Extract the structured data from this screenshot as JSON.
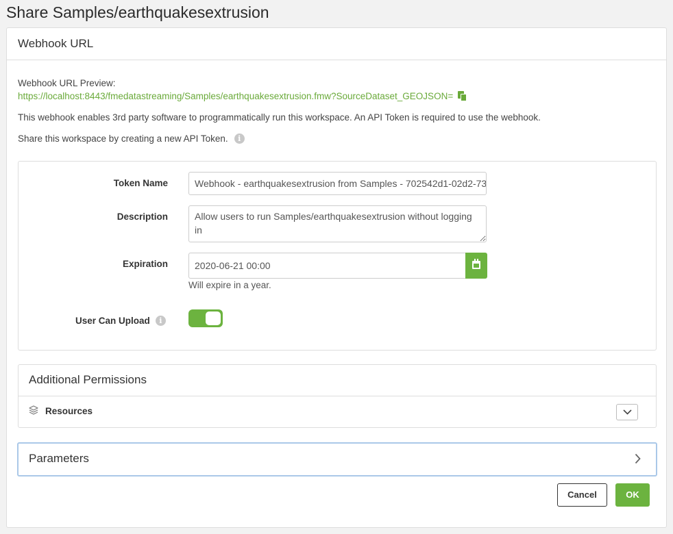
{
  "page": {
    "title": "Share Samples/earthquakesextrusion"
  },
  "webhook": {
    "section_title": "Webhook URL",
    "preview_label": "Webhook URL Preview:",
    "preview_url": "https://localhost:8443/fmedatastreaming/Samples/earthquakesextrusion.fmw?SourceDataset_GEOJSON=",
    "copy_icon": "copy-icon",
    "description": "This webhook enables 3rd party software to programmatically run this workspace. An API Token is required to use the webhook.",
    "share_text": "Share this workspace by creating a new API Token.",
    "info_icon": "info-icon"
  },
  "form": {
    "token_name_label": "Token Name",
    "token_name_value": "Webhook - earthquakesextrusion from Samples - 702542d1-02d2-73",
    "description_label": "Description",
    "description_value": "Allow users to run Samples/earthquakesextrusion without logging in",
    "expiration_label": "Expiration",
    "expiration_value": "2020-06-21 00:00",
    "calendar_icon": "calendar-icon",
    "expiration_hint": "Will expire in a year.",
    "upload_label": "User Can Upload",
    "upload_enabled": true
  },
  "permissions": {
    "section_title": "Additional Permissions",
    "resources_label": "Resources",
    "resources_icon": "layers-icon",
    "expand_icon": "chevron-down-icon"
  },
  "parameters": {
    "label": "Parameters",
    "chevron_icon": "chevron-right-icon"
  },
  "actions": {
    "cancel_label": "Cancel",
    "ok_label": "OK"
  },
  "colors": {
    "accent_green": "#6cb33f",
    "link_green": "#6aaa3a",
    "focus_blue": "#aac8e8"
  }
}
